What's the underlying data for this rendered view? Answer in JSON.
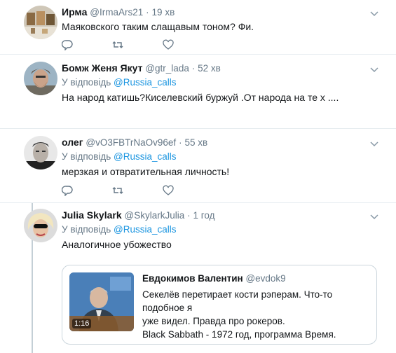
{
  "tweets": [
    {
      "name": "Ирма",
      "handle": "@IrmaArs21",
      "dot": "·",
      "time": "19 хв",
      "text": "Маяковского таким слащавым тоном? Фи."
    },
    {
      "name": "Бомж Женя Якут",
      "handle": "@gtr_lada",
      "dot": "·",
      "time": "52 хв",
      "reply_prefix": "У відповідь",
      "reply_to": "@Russia_calls",
      "text": "На народ катишь?Киселевский буржуй .От народа на те х ...."
    },
    {
      "name": "олег",
      "handle": "@vO3FBTrNaOv96ef",
      "dot": "·",
      "time": "55 хв",
      "reply_prefix": "У відповідь",
      "reply_to": "@Russia_calls",
      "text": "мерзкая и отвратительная личность!"
    },
    {
      "name": "Julia Skylark",
      "handle": "@SkylarkJulia",
      "dot": "·",
      "time": "1 год",
      "reply_prefix": "У відповідь",
      "reply_to": "@Russia_calls",
      "text": "Аналогичное убожество"
    }
  ],
  "quote": {
    "name": "Евдокимов Валентин",
    "handle": "@evdok9",
    "line1": "Секелёв перетирает кости рэперам. Что-то подобное я",
    "line2": "уже видел. Правда про рокеров.",
    "line3": "Black Sabbath - 1972 год, программа Время.",
    "duration": "1:16"
  },
  "icons": {
    "reply": "reply-icon",
    "retweet": "retweet-icon",
    "like": "heart-icon",
    "caret": "chevron-down-icon"
  },
  "colors": {
    "link": "#1b95e0",
    "secondary": "#657786",
    "thread_line": "#c4cfd6",
    "divider": "#e6ecf0"
  }
}
